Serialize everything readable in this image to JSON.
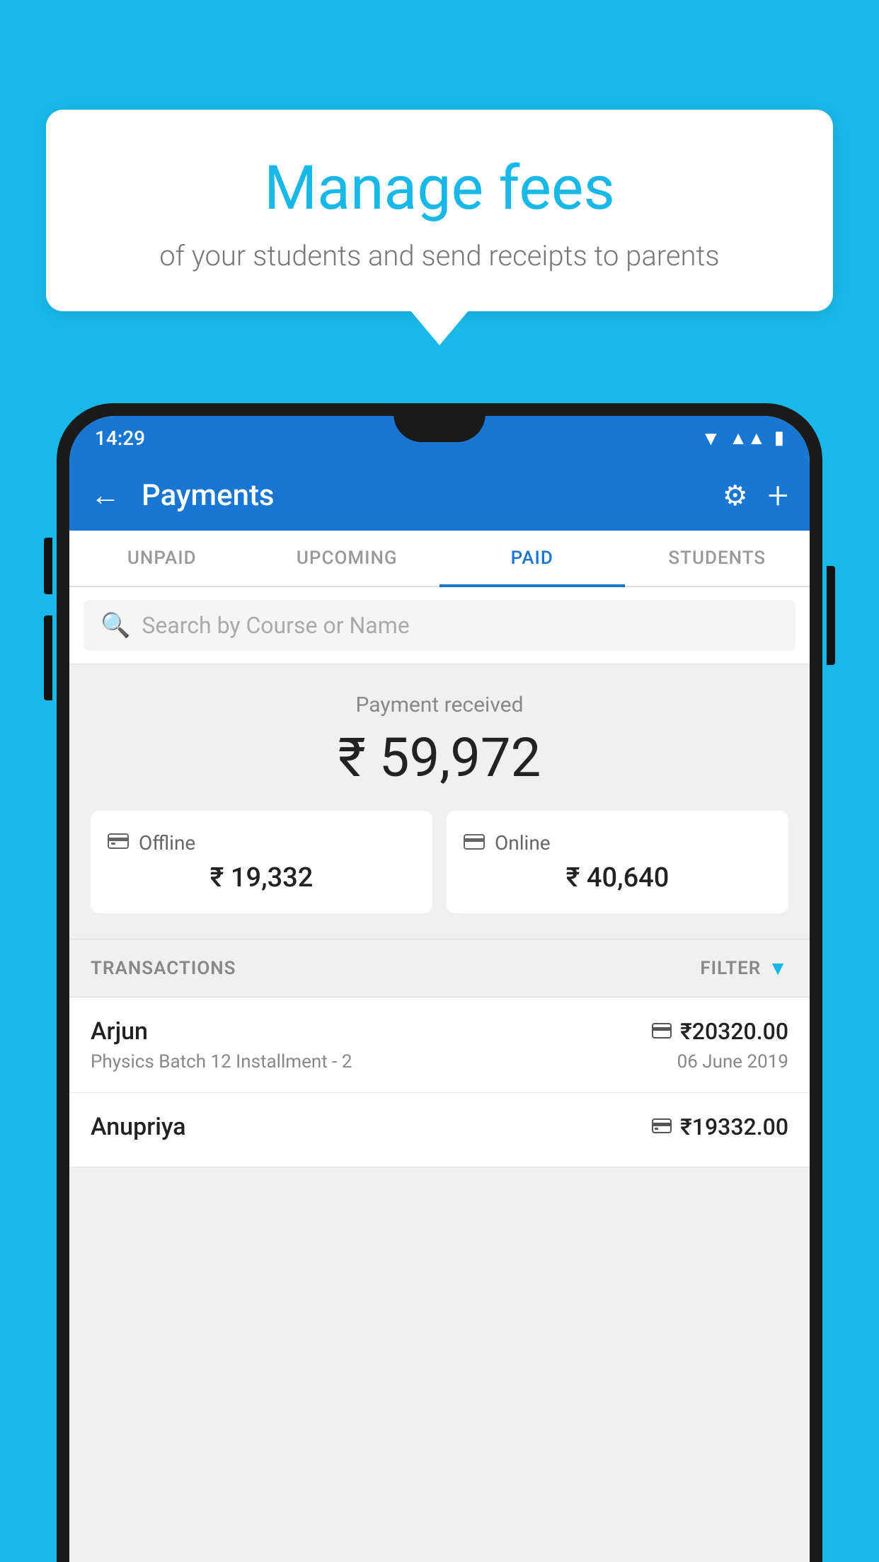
{
  "background_color": "#1ab8e8",
  "bubble": {
    "heading": "Manage fees",
    "subtext": "of your students and send receipts to parents"
  },
  "status_bar": {
    "time": "14:29",
    "color": "#1976d2"
  },
  "app_bar": {
    "title": "Payments",
    "back_label": "←",
    "settings_label": "⚙",
    "add_label": "+"
  },
  "tabs": [
    {
      "label": "UNPAID",
      "active": false
    },
    {
      "label": "UPCOMING",
      "active": false
    },
    {
      "label": "PAID",
      "active": true
    },
    {
      "label": "STUDENTS",
      "active": false
    }
  ],
  "search": {
    "placeholder": "Search by Course or Name"
  },
  "payment_summary": {
    "label": "Payment received",
    "amount": "₹ 59,972",
    "cards": [
      {
        "type": "Offline",
        "icon": "💳",
        "amount": "₹ 19,332"
      },
      {
        "type": "Online",
        "icon": "💳",
        "amount": "₹ 40,640"
      }
    ]
  },
  "transactions": {
    "label": "TRANSACTIONS",
    "filter_label": "FILTER",
    "items": [
      {
        "name": "Arjun",
        "course": "Physics Batch 12 Installment - 2",
        "amount": "₹20320.00",
        "date": "06 June 2019",
        "type": "online"
      },
      {
        "name": "Anupriya",
        "course": "",
        "amount": "₹19332.00",
        "date": "",
        "type": "offline"
      }
    ]
  }
}
